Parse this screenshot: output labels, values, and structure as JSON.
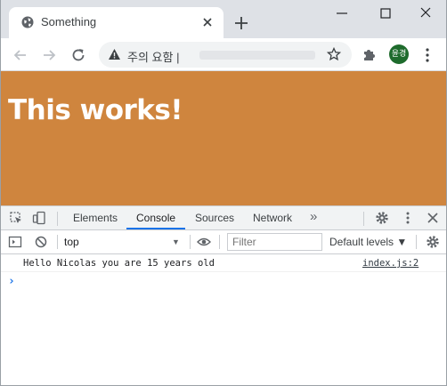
{
  "browser": {
    "tab": {
      "title": "Something",
      "favicon": "globe-icon"
    },
    "omnibox": {
      "security_text": "주의 요함 |"
    },
    "profile": {
      "avatar_text": "윤경",
      "color": "#1e6b2c"
    }
  },
  "page": {
    "heading": "This works!",
    "background": "#cf853e"
  },
  "devtools": {
    "tabs": [
      {
        "label": "Elements",
        "active": false
      },
      {
        "label": "Console",
        "active": true
      },
      {
        "label": "Sources",
        "active": false
      },
      {
        "label": "Network",
        "active": false
      }
    ],
    "more_tabs": "»",
    "context": "top",
    "filter_placeholder": "Filter",
    "levels_label": "Default levels ▼",
    "messages": [
      {
        "text": "Hello Nicolas you are 15 years old",
        "source": "index.js:2"
      }
    ],
    "prompt": "›",
    "accent": "#1a73e8"
  }
}
